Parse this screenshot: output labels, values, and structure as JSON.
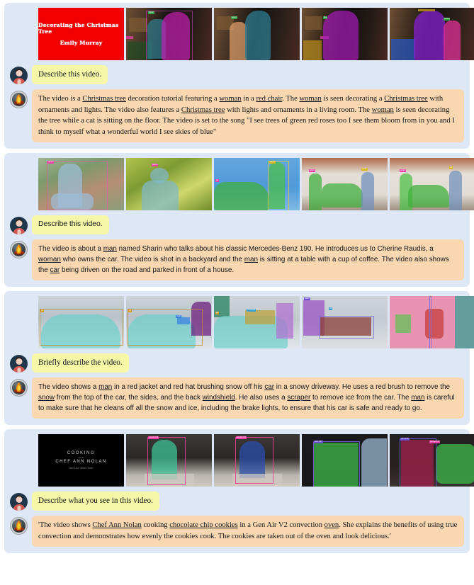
{
  "theme": {
    "page_bg": "#ffffff",
    "block_bg": "#dde7f5",
    "question_bubble_bg": "#f7f7a8",
    "answer_bubble_bg": "#f9d7b0",
    "text_color": "#11161c",
    "user_avatar_bg": "#20364a",
    "bot_avatar_bg": "#cfd3d6"
  },
  "avatars": {
    "user_icon": "person-avatar-icon",
    "assistant_icon": "flame-logo-icon"
  },
  "conversations": [
    {
      "id": "christmas-tree",
      "font": "serif",
      "frames": [
        {
          "kind": "title-card-red",
          "title_line1": "Decorating the Christmas Tree",
          "title_line2": "Emily Murray",
          "alt": "red title card with gothic blackletter text"
        },
        {
          "kind": "living-room",
          "alt": "woman in teal mask decorating magenta-masked Christmas tree",
          "tags": [
            "person",
            "christmas tree"
          ]
        },
        {
          "kind": "living-room",
          "alt": "woman in orange mask beside teal-masked Christmas tree",
          "tags": [
            "person",
            "christmas tree"
          ]
        },
        {
          "kind": "living-room",
          "alt": "magenta-masked Christmas tree in living room",
          "tags": [
            "christmas tree"
          ]
        },
        {
          "kind": "living-room",
          "alt": "purple-masked tree with pink-masked woman",
          "tags": [
            "person",
            "christmas tree"
          ]
        }
      ],
      "question": "Describe this video.",
      "answer_parts": [
        {
          "t": "The video is a ",
          "u": false
        },
        {
          "t": "Christmas tree",
          "u": true
        },
        {
          "t": " decoration tutorial featuring a ",
          "u": false
        },
        {
          "t": "woman",
          "u": true
        },
        {
          "t": " in a ",
          "u": false
        },
        {
          "t": "red chair",
          "u": true
        },
        {
          "t": ". The ",
          "u": false
        },
        {
          "t": "woman",
          "u": true
        },
        {
          "t": " is seen decorating a ",
          "u": false
        },
        {
          "t": "Christmas tree",
          "u": true
        },
        {
          "t": " with ornaments and lights. The video also features a ",
          "u": false
        },
        {
          "t": "Christmas tree",
          "u": true
        },
        {
          "t": " with lights and ornaments in a living room. The ",
          "u": false
        },
        {
          "t": "woman",
          "u": true
        },
        {
          "t": " is seen decorating the tree while a cat is sitting on the floor. The video is set to the song \"I see trees of green red roses too I see them bloom from in you and I think to myself what a wonderful world I see skies of blue\"",
          "u": false
        }
      ]
    },
    {
      "id": "mercedes-benz",
      "font": "sans",
      "frames": [
        {
          "kind": "garden-man",
          "alt": "man with blue mask sitting at a table with coffee",
          "tags": [
            "person"
          ]
        },
        {
          "kind": "garden-man2",
          "alt": "man with teal mask in front of green foliage",
          "tags": [
            "person"
          ]
        },
        {
          "kind": "garage-green",
          "alt": "green-masked car and green-masked woman against blue garage door",
          "tags": [
            "person",
            "car"
          ]
        },
        {
          "kind": "driveway",
          "alt": "green-masked car with two people by a house",
          "tags": [
            "person",
            "car"
          ]
        },
        {
          "kind": "driveway2",
          "alt": "green-masked car parked in front of a house",
          "tags": [
            "person",
            "car"
          ]
        }
      ],
      "question": "Describe this video.",
      "answer_parts": [
        {
          "t": "The video is about a ",
          "u": false
        },
        {
          "t": "man",
          "u": true
        },
        {
          "t": " named Sharin who talks about his classic Mercedes-Benz 190. He introduces us to Cherine Raudis, a ",
          "u": false
        },
        {
          "t": "woman",
          "u": true
        },
        {
          "t": " who owns the car. The video is shot in a backyard and the ",
          "u": false
        },
        {
          "t": "man",
          "u": true
        },
        {
          "t": " is sitting at a table with a cup of coffee. The video also shows the ",
          "u": false
        },
        {
          "t": "car",
          "u": true
        },
        {
          "t": " being driven on the road and parked in front of a house.",
          "u": false
        }
      ]
    },
    {
      "id": "snow-brushing",
      "font": "sans",
      "question_font": "serif",
      "frames": [
        {
          "kind": "snowcar1",
          "alt": "snow-covered car with teal mask in driveway",
          "tags": [
            "car"
          ]
        },
        {
          "kind": "snowcar2",
          "alt": "teal-masked snowy car with purple-masked person",
          "tags": [
            "car",
            "person"
          ]
        },
        {
          "kind": "snowcar3",
          "alt": "teal car mask with yellow windshield region",
          "tags": [
            "car",
            "windshield"
          ]
        },
        {
          "kind": "snowcar4",
          "alt": "purple-masked person brushing snow off car roof",
          "tags": [
            "person",
            "car"
          ]
        },
        {
          "kind": "snowcar5",
          "alt": "close-up of pink-masked brake light",
          "tags": [
            "car"
          ]
        }
      ],
      "question": "Briefly describe the video.",
      "answer_parts": [
        {
          "t": "The video shows a ",
          "u": false
        },
        {
          "t": "man",
          "u": true
        },
        {
          "t": " in a red jacket and red hat brushing snow off his ",
          "u": false
        },
        {
          "t": "car",
          "u": true
        },
        {
          "t": " in a snowy driveway. He uses a red brush to remove the ",
          "u": false
        },
        {
          "t": "snow",
          "u": true
        },
        {
          "t": " from the top of the car, the sides, and the back ",
          "u": false
        },
        {
          "t": "windshield",
          "u": true
        },
        {
          "t": ". He also uses a ",
          "u": false
        },
        {
          "t": "scraper",
          "u": true
        },
        {
          "t": " to remove ice from the car. The ",
          "u": false
        },
        {
          "t": "man",
          "u": true
        },
        {
          "t": " is careful to make sure that he cleans off all the snow and ice, including the brake lights, to ensure that his car is safe and ready to go.",
          "u": false
        }
      ]
    },
    {
      "id": "cooking-cookies",
      "font": "serif",
      "frames": [
        {
          "kind": "title-card-black",
          "title_line1": "COOKING",
          "title_line2": "with",
          "title_line3": "CHEF ANN NOLAN",
          "title_line4": "Jenn-Air Wall Oven",
          "alt": "black title card"
        },
        {
          "kind": "kitchen1",
          "alt": "green-masked chef behind tray of cookies",
          "tags": [
            "woman 0.54"
          ]
        },
        {
          "kind": "kitchen2",
          "alt": "chef in blue apron with pink bounding box",
          "tags": [
            "woman 0.60"
          ]
        },
        {
          "kind": "kitchen3",
          "alt": "green-masked oven interior with person reaching in",
          "tags": [
            "oven 0.57"
          ]
        },
        {
          "kind": "kitchen4",
          "alt": "green-masked hands taking cookies from oven",
          "tags": [
            "oven 0.58",
            "woman 0.65"
          ]
        }
      ],
      "question": "Describe what you see in this video.",
      "answer_parts": [
        {
          "t": "'The video shows ",
          "u": false
        },
        {
          "t": "Chef Ann Nolan",
          "u": true
        },
        {
          "t": " cooking ",
          "u": false
        },
        {
          "t": "chocolate chip cookies",
          "u": true
        },
        {
          "t": " in a Gen Air V2 convection ",
          "u": false
        },
        {
          "t": "oven",
          "u": true
        },
        {
          "t": ". She explains the benefits of using true convection and demonstrates how evenly the cookies cook. The cookies are taken out of the oven and look delicious.'",
          "u": false
        }
      ]
    }
  ]
}
